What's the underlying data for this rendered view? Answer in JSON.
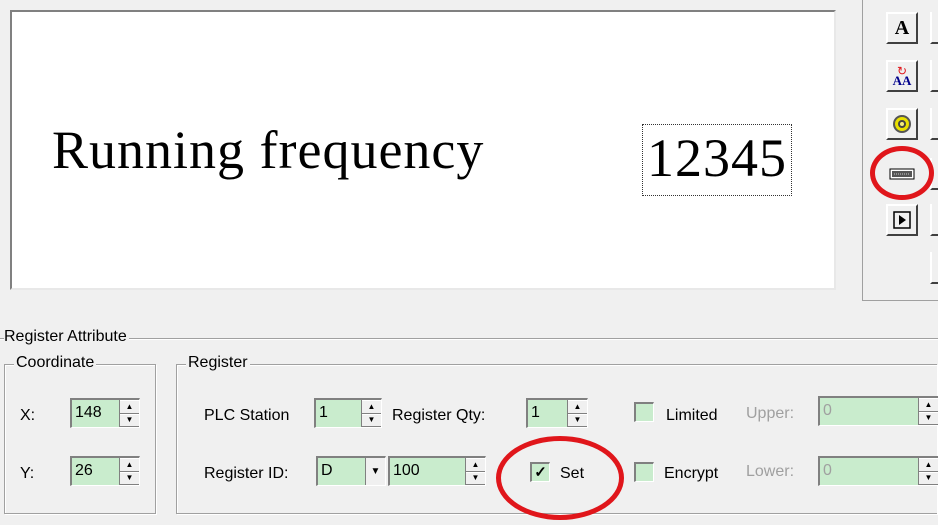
{
  "preview": {
    "label": "Running frequency",
    "value": "12345"
  },
  "toolbar": {
    "buttons": [
      {
        "name": "text-tool-icon",
        "glyph": "A"
      },
      {
        "name": "swap-text-tool-icon",
        "glyph": "AA"
      },
      {
        "name": "lamp-tool-icon",
        "glyph": "◎"
      },
      {
        "name": "register-display-tool-icon",
        "glyph": "▭"
      },
      {
        "name": "play-button-tool-icon",
        "glyph": "▸"
      }
    ]
  },
  "register_attribute": {
    "title": "Register Attribute",
    "coordinate": {
      "title": "Coordinate",
      "x_label": "X:",
      "x_value": "148",
      "y_label": "Y:",
      "y_value": "26"
    },
    "register": {
      "title": "Register",
      "plc_station_label": "PLC Station",
      "plc_station_value": "1",
      "register_qty_label": "Register Qty:",
      "register_qty_value": "1",
      "register_id_label": "Register ID:",
      "register_id_type": "D",
      "register_id_value": "100",
      "set_label": "Set",
      "set_checked": true,
      "limited_label": "Limited",
      "limited_checked": false,
      "encrypt_label": "Encrypt",
      "encrypt_checked": false,
      "upper_label": "Upper:",
      "upper_value": "0",
      "lower_label": "Lower:",
      "lower_value": "0"
    }
  },
  "colors": {
    "highlight_circle": "#e0161b",
    "field_background": "#c9eccd",
    "window_background": "#f0f0f0"
  }
}
